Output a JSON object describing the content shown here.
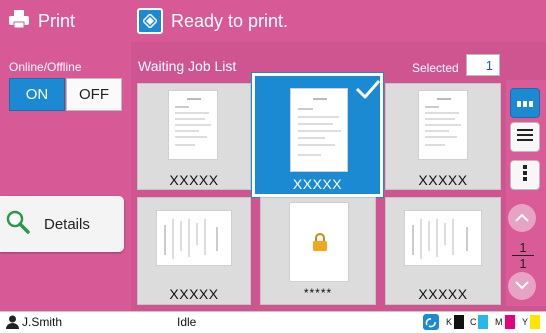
{
  "sidebar": {
    "title": "Print",
    "online_offline_label": "Online/Offline",
    "on_label": "ON",
    "off_label": "OFF",
    "details_label": "Details"
  },
  "topbar": {
    "status_text": "Ready to print."
  },
  "job_list": {
    "title": "Waiting Job List",
    "selected_label": "Selected",
    "selected_count": "1",
    "jobs": [
      {
        "name": "XXXXX",
        "selected": false,
        "locked": false
      },
      {
        "name": "XXXXX",
        "selected": true,
        "locked": false
      },
      {
        "name": "XXXXX",
        "selected": false,
        "locked": false
      },
      {
        "name": "XXXXX",
        "selected": false,
        "locked": false
      },
      {
        "name": "*****",
        "selected": false,
        "locked": true
      },
      {
        "name": "XXXXX",
        "selected": false,
        "locked": false
      }
    ]
  },
  "pager": {
    "current": "1",
    "total": "1"
  },
  "status_bar": {
    "user": "J.Smith",
    "state": "Idle",
    "inks": [
      {
        "label": "K",
        "color": "#111111"
      },
      {
        "label": "C",
        "color": "#29b6e8"
      },
      {
        "label": "M",
        "color": "#e4007f"
      },
      {
        "label": "Y",
        "color": "#ffe600"
      }
    ]
  },
  "colors": {
    "accent": "#1c8ad2",
    "brand": "#d75a97"
  }
}
